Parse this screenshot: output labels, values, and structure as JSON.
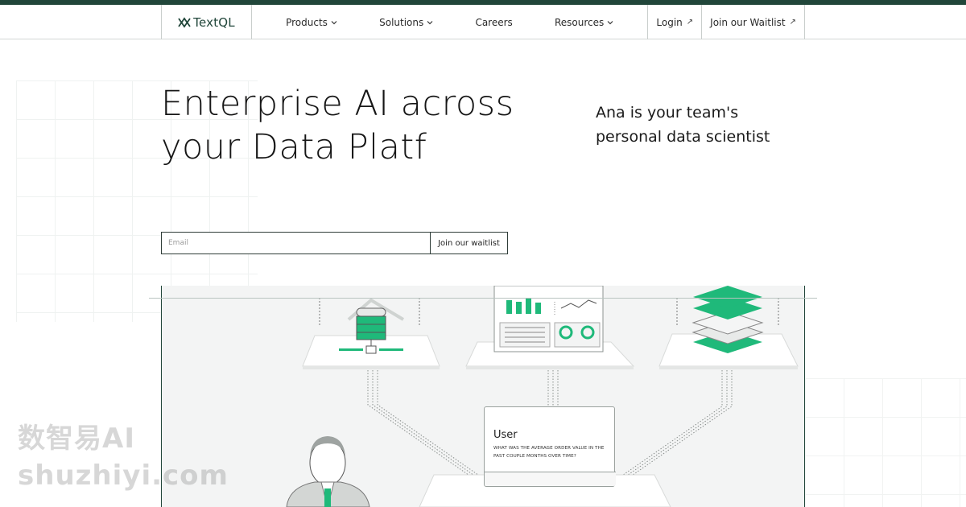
{
  "nav": {
    "logo": "TextQL",
    "links": [
      "Products",
      "Solutions",
      "Careers",
      "Resources"
    ],
    "login": "Login",
    "waitlist": "Join our Waitlist"
  },
  "hero": {
    "title_line1": "Enterprise AI across",
    "title_line2": "your Data Platf",
    "subtitle": "Ana is your team's personal data scientist"
  },
  "form": {
    "email_placeholder": "Email",
    "button": "Join our waitlist"
  },
  "illustration": {
    "user_label": "User",
    "question": "What was the average order value in the past couple months over time?"
  },
  "watermark": {
    "line1": "数智易AI",
    "line2": "shuzhiyi.com"
  },
  "colors": {
    "brand": "#21463a",
    "accent": "#1fb97a"
  }
}
